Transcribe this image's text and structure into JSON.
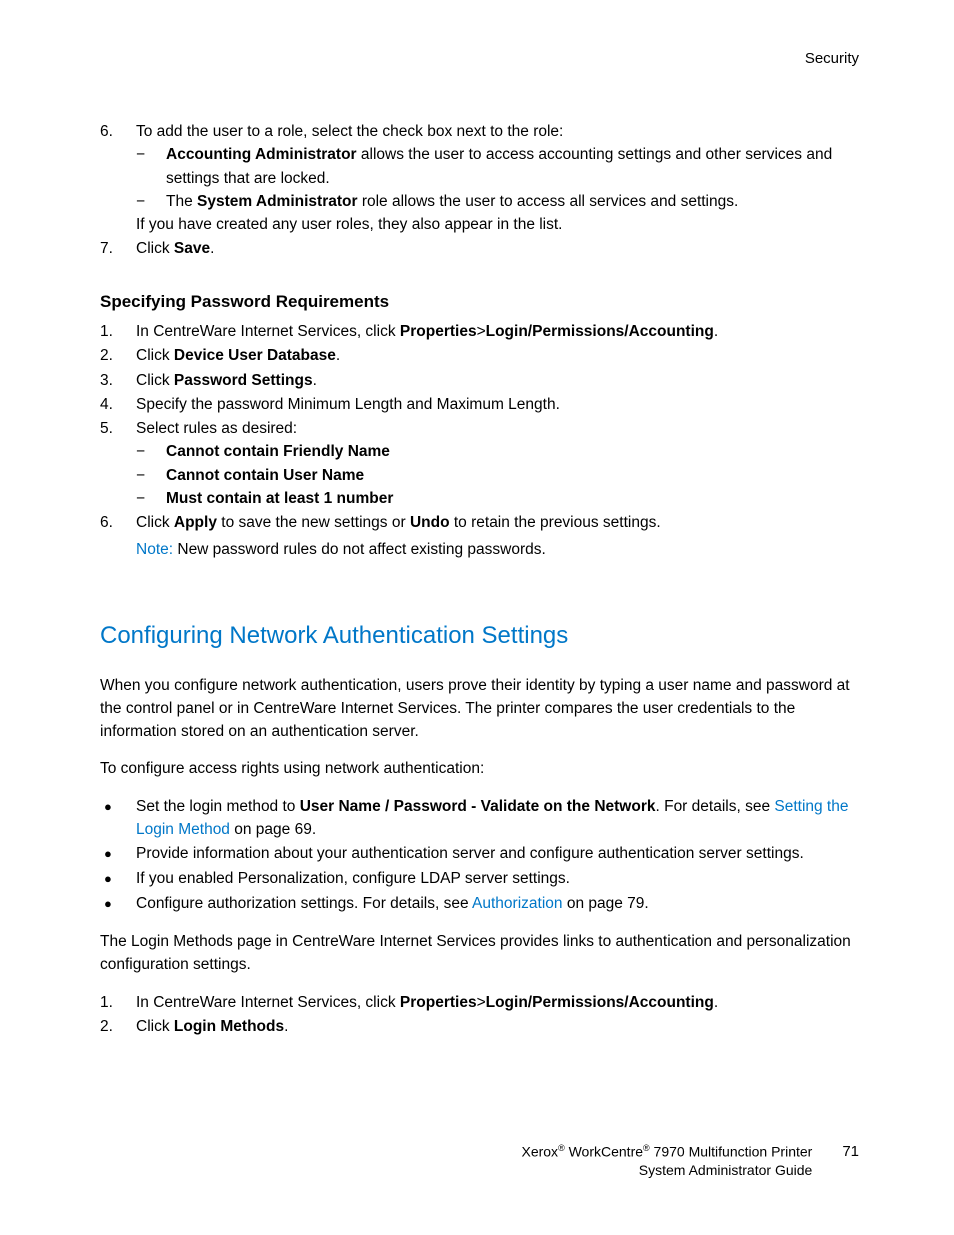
{
  "header": {
    "right": "Security"
  },
  "listA": {
    "items": [
      {
        "num": "6.",
        "text_a": "To add the user to a role, select the check box next to the role:",
        "sub": [
          {
            "bold": "Accounting Administrator",
            "rest": " allows the user to access accounting settings and other services and settings that are locked."
          },
          {
            "pre": "The ",
            "bold": "System Administrator",
            "rest": " role allows the user to access all services and settings."
          }
        ],
        "tail": "If you have created any user roles, they also appear in the list."
      },
      {
        "num": "7.",
        "text_a": "Click ",
        "bold": "Save",
        "text_b": "."
      }
    ]
  },
  "sectionB": {
    "title": "Specifying Password Requirements",
    "items": [
      {
        "num": "1.",
        "text_a": "In CentreWare Internet Services, click ",
        "bold": "Properties",
        "gt": ">",
        "bold2": "Login/Permissions/Accounting",
        "text_b": "."
      },
      {
        "num": "2.",
        "text_a": "Click ",
        "bold": "Device User Database",
        "text_b": "."
      },
      {
        "num": "3.",
        "text_a": "Click ",
        "bold": "Password Settings",
        "text_b": "."
      },
      {
        "num": "4.",
        "text_a": "Specify the password Minimum Length and Maximum Length."
      },
      {
        "num": "5.",
        "text_a": "Select rules as desired:",
        "sub": [
          {
            "bold": "Cannot contain Friendly Name"
          },
          {
            "bold": "Cannot contain User Name"
          },
          {
            "bold": "Must contain at least 1 number"
          }
        ]
      },
      {
        "num": "6.",
        "text_a": "Click ",
        "bold": "Apply",
        "mid": " to save the new settings or ",
        "bold2": "Undo",
        "text_b": " to retain the previous settings."
      }
    ],
    "note_label": "Note:",
    "note_text": " New password rules do not affect existing passwords."
  },
  "sectionC": {
    "heading": "Configuring Network Authentication Settings",
    "para1": "When you configure network authentication, users prove their identity by typing a user name and password at the control panel or in CentreWare Internet Services. The printer compares the user credentials to the information stored on an authentication server.",
    "para2": "To configure access rights using network authentication:",
    "bullets": [
      {
        "text_a": "Set the login method to ",
        "bold": "User Name / Password - Validate on the Network",
        "mid": ". For details, see ",
        "link": "Setting the Login Method",
        "tail": " on page 69."
      },
      {
        "text_a": "Provide information about your authentication server and configure authentication server settings."
      },
      {
        "text_a": "If you enabled Personalization, configure LDAP server settings."
      },
      {
        "text_a": "Configure authorization settings. For details, see ",
        "link": "Authorization",
        "tail": " on page 79."
      }
    ],
    "para3": "The Login Methods page in CentreWare Internet Services provides links to authentication and personalization configuration settings.",
    "steps": [
      {
        "num": "1.",
        "text_a": "In CentreWare Internet Services, click ",
        "bold": "Properties",
        "gt": ">",
        "bold2": "Login/Permissions/Accounting",
        "text_b": "."
      },
      {
        "num": "2.",
        "text_a": "Click ",
        "bold": "Login Methods",
        "text_b": "."
      }
    ]
  },
  "footer": {
    "line1_a": "Xerox",
    "line1_b": " WorkCentre",
    "line1_c": " 7970 Multifunction Printer",
    "line2": "System Administrator Guide",
    "page": "71"
  }
}
